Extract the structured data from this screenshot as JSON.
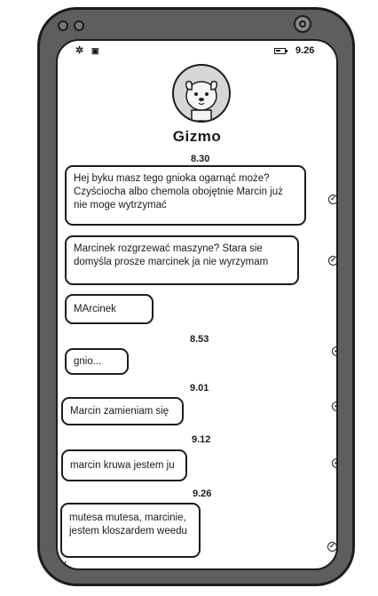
{
  "status_bar": {
    "left_icons": [
      "gear-icon",
      "sim-icon"
    ],
    "time": "9.26",
    "battery_icon": "battery-icon"
  },
  "contact": {
    "name": "Gizmo",
    "avatar_icon": "dog-avatar-icon"
  },
  "messages": [
    {
      "timestamp": "8.30",
      "text": "Hej byku masz tego gnioka ogarnąć może? Czyściocha albo chemola obojętnie Marcin już nie moge wytrzymać",
      "status": "sent-check"
    },
    {
      "text": "Marcinek rozgrzewać maszyne? Stara sie domyśla prosze marcinek ja nie wyrzymam",
      "status": "sent-check"
    },
    {
      "text": "MArcinek"
    },
    {
      "timestamp": "8.53",
      "text": "gnio...",
      "status": "sent-check"
    },
    {
      "timestamp": "9.01",
      "text": "Marcin zamieniam się",
      "status": "sent-check"
    },
    {
      "timestamp": "9.12",
      "text": "marcin kruwa jestem ju",
      "status": "sent-check"
    },
    {
      "timestamp": "9.26",
      "text": "mutesa mutesa, marcinie, jestem kloszardem weedu",
      "status": "sent-check"
    }
  ]
}
